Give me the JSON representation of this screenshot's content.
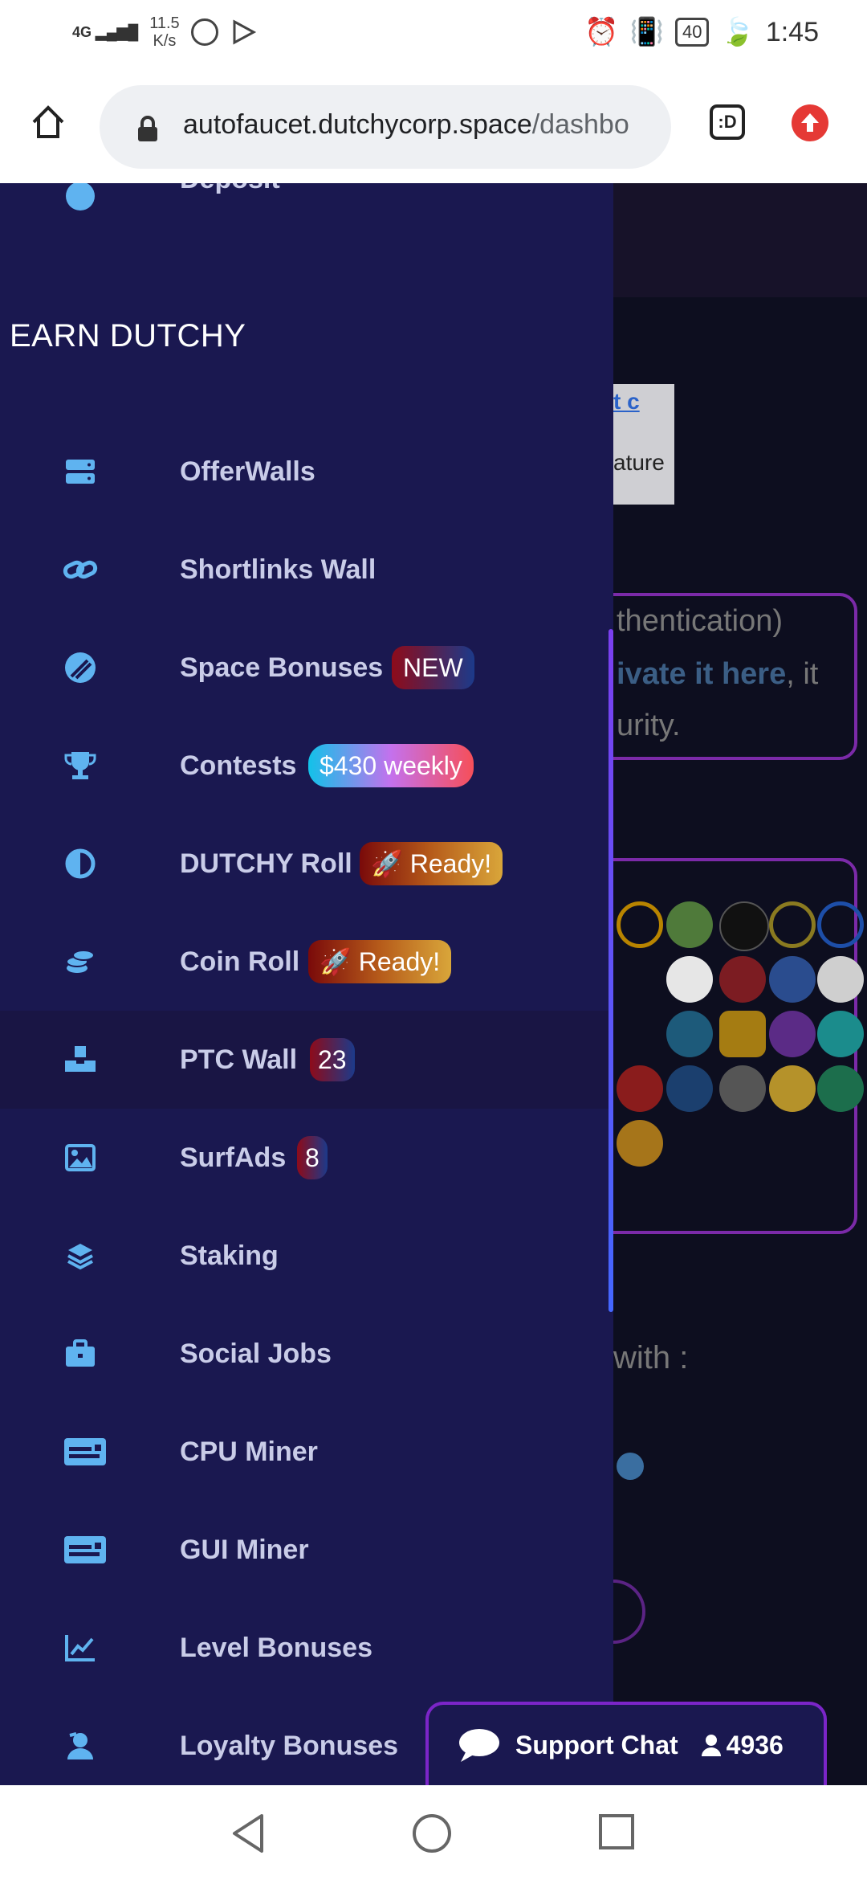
{
  "status_bar": {
    "signal": "4G",
    "speed_value": "11.5",
    "speed_unit": "K/s",
    "battery": "40",
    "time": "1:45"
  },
  "browser": {
    "url_main": "autofaucet.dutchycorp.space",
    "url_rest": "/dashbo",
    "tabs_label": ":D"
  },
  "drawer": {
    "top_item": "Deposit",
    "section_title": "EARN DUTCHY",
    "items": [
      {
        "label": "OfferWalls",
        "icon": "server-icon"
      },
      {
        "label": "Shortlinks Wall",
        "icon": "link-icon"
      },
      {
        "label": "Space Bonuses",
        "icon": "meteor-icon",
        "badge": "NEW"
      },
      {
        "label": "Contests",
        "icon": "trophy-icon",
        "badge": "$430 weekly"
      },
      {
        "label": "DUTCHY Roll",
        "icon": "half-circle-icon",
        "badge": "Ready!"
      },
      {
        "label": "Coin Roll",
        "icon": "coins-icon",
        "badge": "Ready!"
      },
      {
        "label": "PTC Wall",
        "icon": "cubes-icon",
        "badge": "23"
      },
      {
        "label": "SurfAds",
        "icon": "image-icon",
        "badge": "8"
      },
      {
        "label": "Staking",
        "icon": "layers-icon"
      },
      {
        "label": "Social Jobs",
        "icon": "briefcase-icon"
      },
      {
        "label": "CPU Miner",
        "icon": "id-card-icon"
      },
      {
        "label": "GUI Miner",
        "icon": "id-card-icon"
      },
      {
        "label": "Level Bonuses",
        "icon": "chart-line-icon"
      },
      {
        "label": "Loyalty Bonuses",
        "icon": "user-heart-icon"
      }
    ]
  },
  "background": {
    "card1_text": "ature",
    "card2_line1": "thentication)",
    "card2_link": "ivate it here",
    "card2_line2_rest": ", it",
    "card2_line3": "urity.",
    "with_text": "with :"
  },
  "support_chat": {
    "label": "Support Chat",
    "count": "4936"
  },
  "colors": {
    "drawer_bg": "#1a1850",
    "icon_accent": "#5fb3f0",
    "chat_border": "#7b25c8"
  }
}
